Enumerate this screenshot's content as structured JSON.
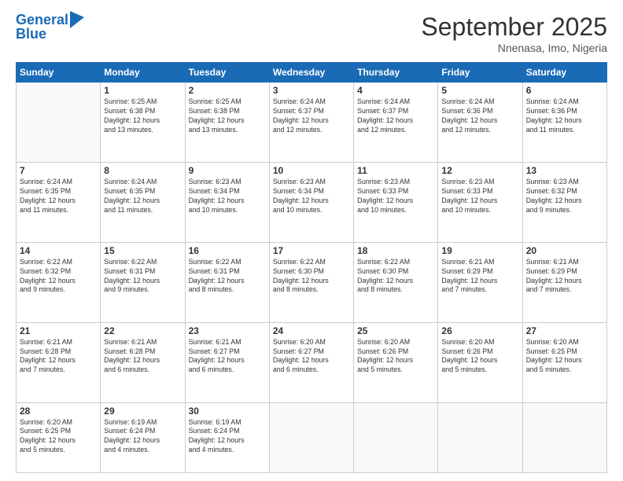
{
  "logo": {
    "line1": "General",
    "line2": "Blue"
  },
  "title": "September 2025",
  "location": "Nnenasa, Imo, Nigeria",
  "weekdays": [
    "Sunday",
    "Monday",
    "Tuesday",
    "Wednesday",
    "Thursday",
    "Friday",
    "Saturday"
  ],
  "weeks": [
    [
      {
        "day": "",
        "info": ""
      },
      {
        "day": "1",
        "info": "Sunrise: 6:25 AM\nSunset: 6:38 PM\nDaylight: 12 hours\nand 13 minutes."
      },
      {
        "day": "2",
        "info": "Sunrise: 6:25 AM\nSunset: 6:38 PM\nDaylight: 12 hours\nand 13 minutes."
      },
      {
        "day": "3",
        "info": "Sunrise: 6:24 AM\nSunset: 6:37 PM\nDaylight: 12 hours\nand 12 minutes."
      },
      {
        "day": "4",
        "info": "Sunrise: 6:24 AM\nSunset: 6:37 PM\nDaylight: 12 hours\nand 12 minutes."
      },
      {
        "day": "5",
        "info": "Sunrise: 6:24 AM\nSunset: 6:36 PM\nDaylight: 12 hours\nand 12 minutes."
      },
      {
        "day": "6",
        "info": "Sunrise: 6:24 AM\nSunset: 6:36 PM\nDaylight: 12 hours\nand 11 minutes."
      }
    ],
    [
      {
        "day": "7",
        "info": "Sunrise: 6:24 AM\nSunset: 6:35 PM\nDaylight: 12 hours\nand 11 minutes."
      },
      {
        "day": "8",
        "info": "Sunrise: 6:24 AM\nSunset: 6:35 PM\nDaylight: 12 hours\nand 11 minutes."
      },
      {
        "day": "9",
        "info": "Sunrise: 6:23 AM\nSunset: 6:34 PM\nDaylight: 12 hours\nand 10 minutes."
      },
      {
        "day": "10",
        "info": "Sunrise: 6:23 AM\nSunset: 6:34 PM\nDaylight: 12 hours\nand 10 minutes."
      },
      {
        "day": "11",
        "info": "Sunrise: 6:23 AM\nSunset: 6:33 PM\nDaylight: 12 hours\nand 10 minutes."
      },
      {
        "day": "12",
        "info": "Sunrise: 6:23 AM\nSunset: 6:33 PM\nDaylight: 12 hours\nand 10 minutes."
      },
      {
        "day": "13",
        "info": "Sunrise: 6:23 AM\nSunset: 6:32 PM\nDaylight: 12 hours\nand 9 minutes."
      }
    ],
    [
      {
        "day": "14",
        "info": "Sunrise: 6:22 AM\nSunset: 6:32 PM\nDaylight: 12 hours\nand 9 minutes."
      },
      {
        "day": "15",
        "info": "Sunrise: 6:22 AM\nSunset: 6:31 PM\nDaylight: 12 hours\nand 9 minutes."
      },
      {
        "day": "16",
        "info": "Sunrise: 6:22 AM\nSunset: 6:31 PM\nDaylight: 12 hours\nand 8 minutes."
      },
      {
        "day": "17",
        "info": "Sunrise: 6:22 AM\nSunset: 6:30 PM\nDaylight: 12 hours\nand 8 minutes."
      },
      {
        "day": "18",
        "info": "Sunrise: 6:22 AM\nSunset: 6:30 PM\nDaylight: 12 hours\nand 8 minutes."
      },
      {
        "day": "19",
        "info": "Sunrise: 6:21 AM\nSunset: 6:29 PM\nDaylight: 12 hours\nand 7 minutes."
      },
      {
        "day": "20",
        "info": "Sunrise: 6:21 AM\nSunset: 6:29 PM\nDaylight: 12 hours\nand 7 minutes."
      }
    ],
    [
      {
        "day": "21",
        "info": "Sunrise: 6:21 AM\nSunset: 6:28 PM\nDaylight: 12 hours\nand 7 minutes."
      },
      {
        "day": "22",
        "info": "Sunrise: 6:21 AM\nSunset: 6:28 PM\nDaylight: 12 hours\nand 6 minutes."
      },
      {
        "day": "23",
        "info": "Sunrise: 6:21 AM\nSunset: 6:27 PM\nDaylight: 12 hours\nand 6 minutes."
      },
      {
        "day": "24",
        "info": "Sunrise: 6:20 AM\nSunset: 6:27 PM\nDaylight: 12 hours\nand 6 minutes."
      },
      {
        "day": "25",
        "info": "Sunrise: 6:20 AM\nSunset: 6:26 PM\nDaylight: 12 hours\nand 5 minutes."
      },
      {
        "day": "26",
        "info": "Sunrise: 6:20 AM\nSunset: 6:26 PM\nDaylight: 12 hours\nand 5 minutes."
      },
      {
        "day": "27",
        "info": "Sunrise: 6:20 AM\nSunset: 6:25 PM\nDaylight: 12 hours\nand 5 minutes."
      }
    ],
    [
      {
        "day": "28",
        "info": "Sunrise: 6:20 AM\nSunset: 6:25 PM\nDaylight: 12 hours\nand 5 minutes."
      },
      {
        "day": "29",
        "info": "Sunrise: 6:19 AM\nSunset: 6:24 PM\nDaylight: 12 hours\nand 4 minutes."
      },
      {
        "day": "30",
        "info": "Sunrise: 6:19 AM\nSunset: 6:24 PM\nDaylight: 12 hours\nand 4 minutes."
      },
      {
        "day": "",
        "info": ""
      },
      {
        "day": "",
        "info": ""
      },
      {
        "day": "",
        "info": ""
      },
      {
        "day": "",
        "info": ""
      }
    ]
  ]
}
